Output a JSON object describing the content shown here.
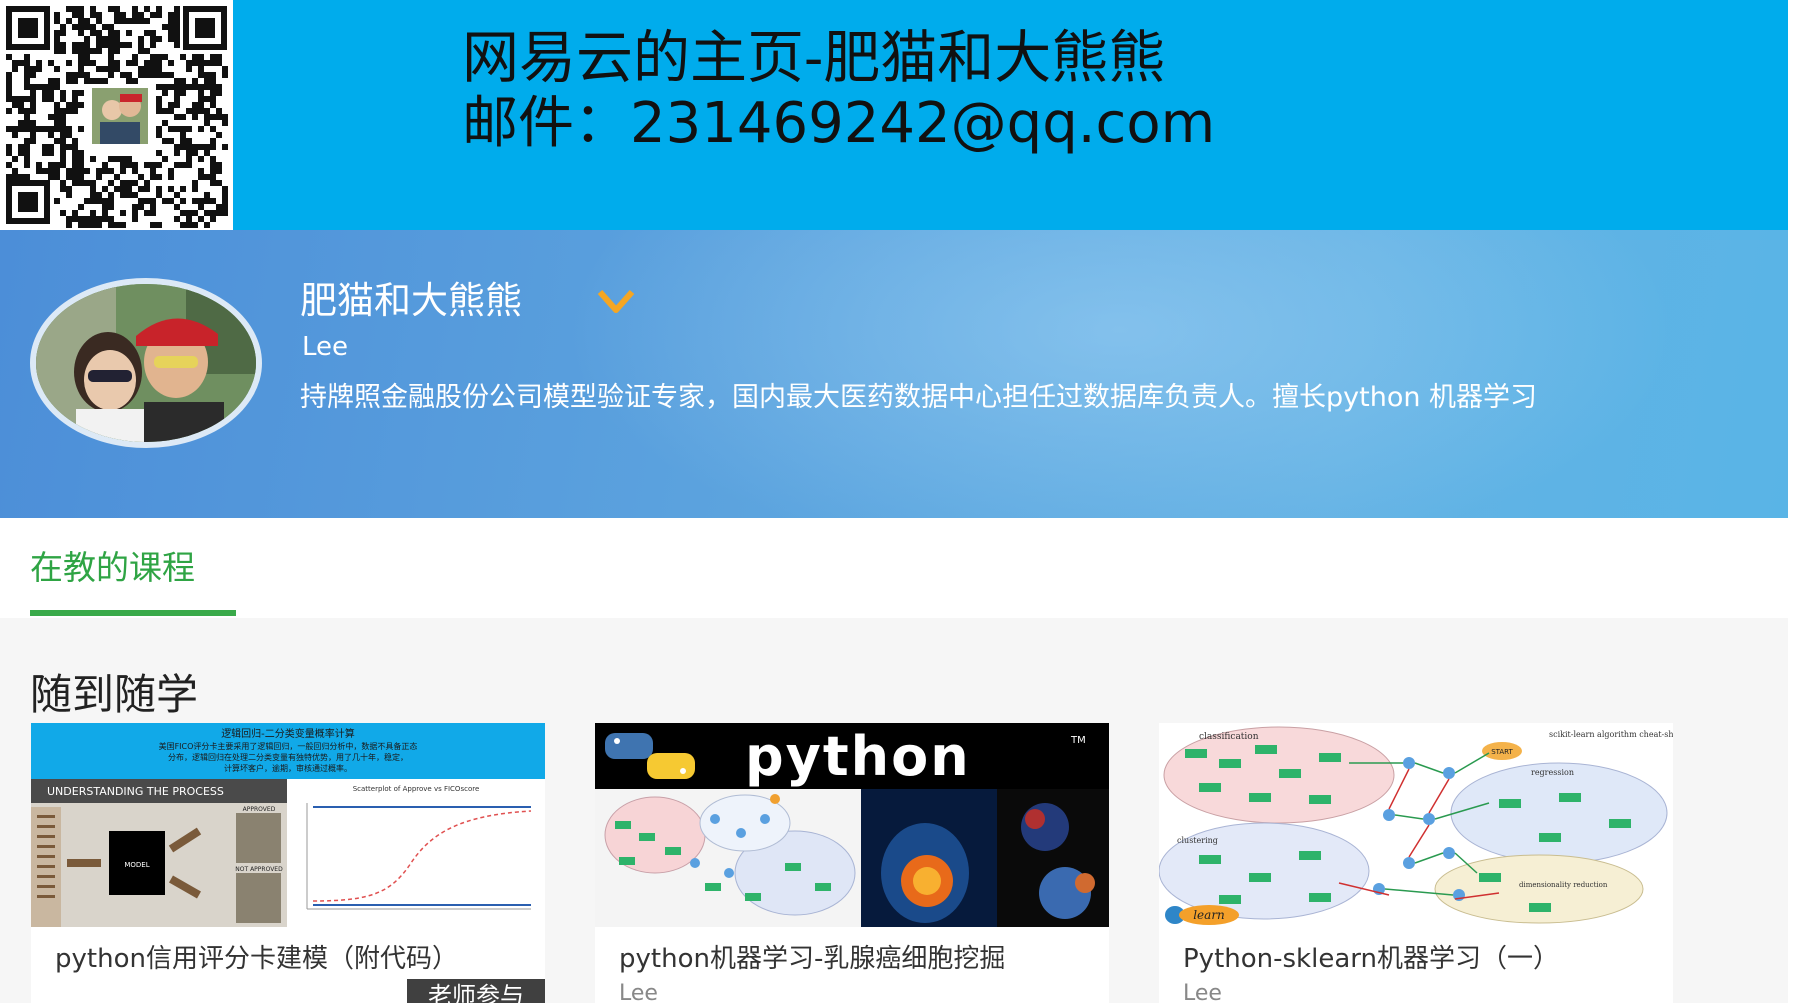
{
  "banner": {
    "title": "网易云的主页-肥猫和大熊熊",
    "mail": "邮件：231469242@qq.com",
    "qr_icon": "qr-code",
    "color": "#00acec"
  },
  "profile": {
    "name": "肥猫和大熊熊",
    "english_name": "Lee",
    "bio": "持牌照金融股份公司模型验证专家，国内最大医药数据中心担任过数据库负责人。擅长python 机器学习",
    "verified_icon": "chevron-down",
    "accent": "#f5a623"
  },
  "tabs": {
    "active_label": "在教的课程",
    "accent": "#3aaa4a"
  },
  "section": {
    "title": "随到随学"
  },
  "courses": [
    {
      "title": "python信用评分卡建模（附代码）",
      "author": "",
      "badge": "老师参与",
      "thumb": {
        "heading": "逻辑回归-二分类变量概率计算",
        "line1": "美国FICO评分卡主要采用了逻辑回归，一般回归分析中，数据不具备正态",
        "line2": "分布，逻辑回归在处理二分类变量有独特优势，用了几十年，稳定，",
        "line3": "计算坏客户，逾期，审核通过概率。",
        "band": "UNDERSTANDING THE PROCESS",
        "model": "MODEL",
        "approved": "APPROVED",
        "not_approved": "NOT APPROVED",
        "plot_title": "Scatterplot of Approve vs FICOscore"
      }
    },
    {
      "title": "python机器学习-乳腺癌细胞挖掘",
      "author": "Lee",
      "thumb": {
        "word": "python",
        "tm": "TM"
      }
    },
    {
      "title": "Python-sklearn机器学习（一）",
      "author": "Lee",
      "thumb": {
        "classification": "classification",
        "cheat": "scikit-learn algorithm cheat-sheet",
        "start": "START",
        "regression": "regression",
        "clustering": "clustering",
        "dimensionality": "dimensionality reduction",
        "logo": "learn"
      }
    }
  ]
}
